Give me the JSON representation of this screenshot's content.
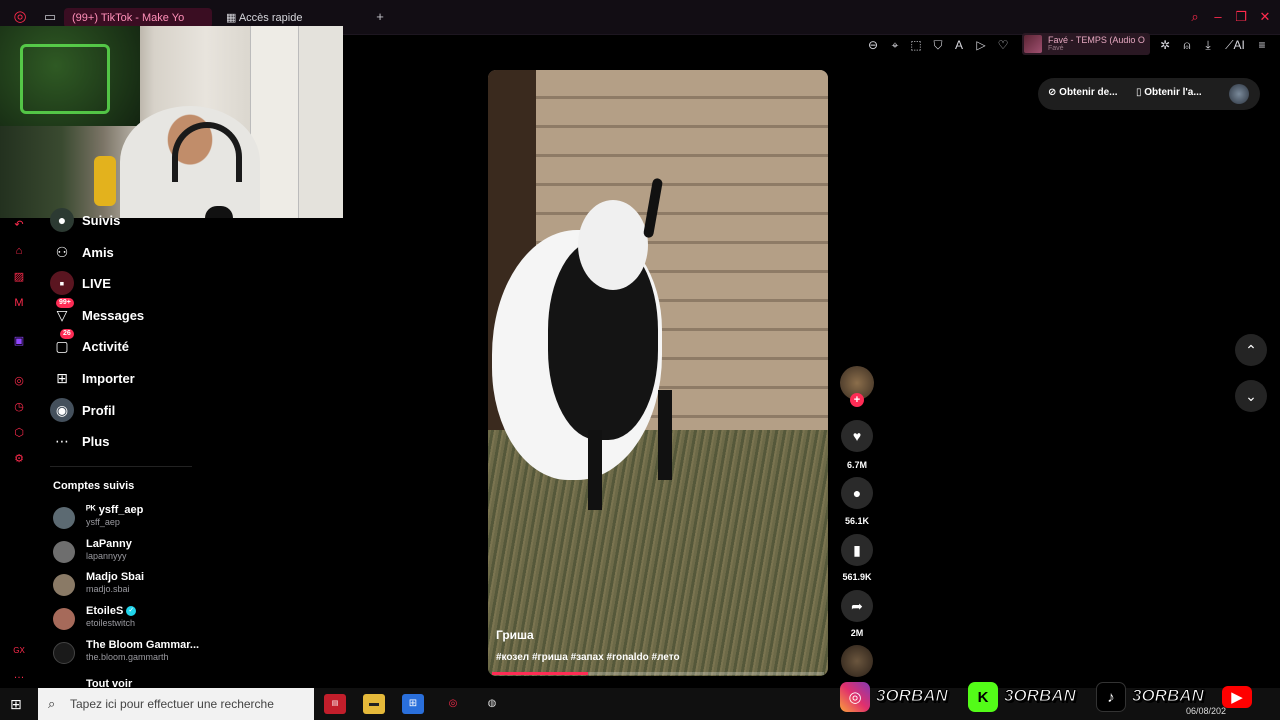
{
  "browser": {
    "tabs": [
      {
        "label": "(99+) TikTok - Make Yo"
      },
      {
        "label": "Accès rapide"
      }
    ],
    "new_tab": "+",
    "media": {
      "title": "Favé - TEMPS (Audio O",
      "artist": "Favé"
    },
    "ai_label": "AI"
  },
  "nav": {
    "items": [
      {
        "label": "Suivis",
        "icon": "following-icon"
      },
      {
        "label": "Amis",
        "icon": "friends-icon"
      },
      {
        "label": "LIVE",
        "icon": "live-icon"
      },
      {
        "label": "Messages",
        "icon": "messages-icon",
        "badge": "99+"
      },
      {
        "label": "Activité",
        "icon": "activity-icon",
        "badge": "26"
      },
      {
        "label": "Importer",
        "icon": "upload-icon"
      },
      {
        "label": "Profil",
        "icon": "profile-icon"
      },
      {
        "label": "Plus",
        "icon": "more-icon"
      }
    ],
    "following_title": "Comptes suivis",
    "following": [
      {
        "name": "ᴾᴷ ysff_aep",
        "handle": "ysff_aep"
      },
      {
        "name": "LaPanny",
        "handle": "lapannyyy"
      },
      {
        "name": "Madjo Sbai",
        "handle": "madjo.sbai"
      },
      {
        "name": "EtoileS",
        "handle": "etoilestwitch",
        "verified": true
      },
      {
        "name": "The Bloom Gammar...",
        "handle": "the.bloom.gammarth"
      }
    ],
    "see_all": "Tout voir"
  },
  "video": {
    "caption": "Гриша",
    "tags": "#козел #гриша #запах #ronaldo #лето",
    "progress": 0.29
  },
  "actions": {
    "likes": "6.7M",
    "comments": "56.1K",
    "saves": "561.9K",
    "shares": "2M"
  },
  "right_bar": {
    "get_desktop": "Obtenir de...",
    "get_app": "Obtenir l'a..."
  },
  "taskbar": {
    "search_placeholder": "Tapez ici pour effectuer une recherche",
    "date": "06/08/202"
  },
  "overlay": {
    "handle": "3ORBAN"
  },
  "colors": {
    "accent": "#fe2c55",
    "opera": "#ff2b4d"
  }
}
